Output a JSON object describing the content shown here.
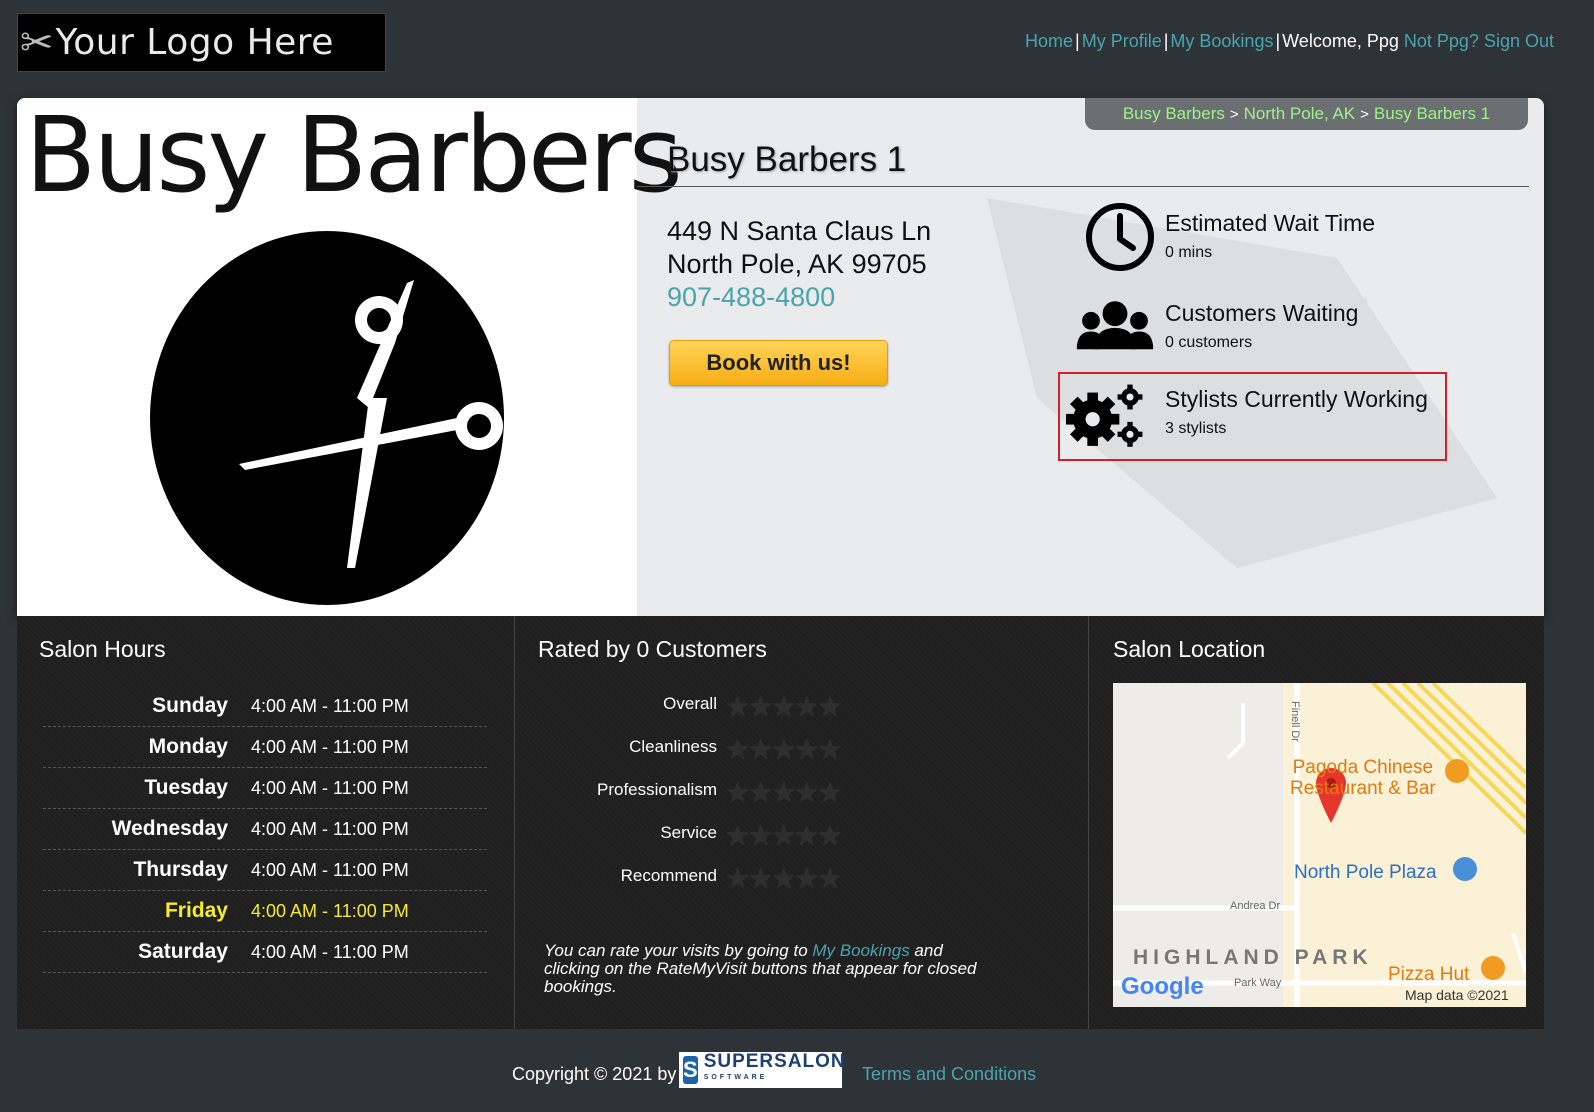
{
  "header": {
    "logo_text": "Your Logo Here",
    "nav": {
      "home": "Home",
      "my_profile": "My Profile",
      "my_bookings": "My Bookings",
      "welcome": "Welcome, Ppg",
      "not_user": "Not Ppg?",
      "sign_out": "Sign Out"
    }
  },
  "breadcrumb": [
    "Busy Barbers",
    "North Pole, AK",
    "Busy Barbers 1"
  ],
  "salon": {
    "brand_name": "Busy Barbers",
    "title": "Busy Barbers 1",
    "address_line1": "449 N Santa Claus Ln",
    "address_line2": "North Pole, AK 99705",
    "phone": "907-488-4800",
    "book_label": "Book with us!"
  },
  "stats": {
    "wait": {
      "title": "Estimated Wait Time",
      "value": "0 mins",
      "icon": "clock-icon"
    },
    "customers": {
      "title": "Customers Waiting",
      "value": "0 customers",
      "icon": "group-icon"
    },
    "stylists": {
      "title": "Stylists Currently Working",
      "value": "3 stylists",
      "icon": "gears-icon"
    }
  },
  "hours": {
    "title": "Salon Hours",
    "today": "Friday",
    "rows": [
      {
        "day": "Sunday",
        "time": "4:00 AM - 11:00 PM"
      },
      {
        "day": "Monday",
        "time": "4:00 AM - 11:00 PM"
      },
      {
        "day": "Tuesday",
        "time": "4:00 AM - 11:00 PM"
      },
      {
        "day": "Wednesday",
        "time": "4:00 AM - 11:00 PM"
      },
      {
        "day": "Thursday",
        "time": "4:00 AM - 11:00 PM"
      },
      {
        "day": "Friday",
        "time": "4:00 AM - 11:00 PM"
      },
      {
        "day": "Saturday",
        "time": "4:00 AM - 11:00 PM"
      }
    ]
  },
  "ratings": {
    "title": "Rated by 0 Customers",
    "categories": [
      {
        "label": "Overall",
        "stars": 0
      },
      {
        "label": "Cleanliness",
        "stars": 0
      },
      {
        "label": "Professionalism",
        "stars": 0
      },
      {
        "label": "Service",
        "stars": 0
      },
      {
        "label": "Recommend",
        "stars": 0
      }
    ],
    "note_before": "You can rate your visits by going to ",
    "note_link": "My Bookings",
    "note_after": " and clicking on the RateMyVisit buttons that appear for closed bookings."
  },
  "location": {
    "title": "Salon Location",
    "map_labels": {
      "street1": "Finell Dr",
      "poi1_line1": "Pagoda Chinese",
      "poi1_line2": "Restaurant & Bar",
      "poi2": "North Pole Plaza",
      "street2": "Andrea Dr",
      "area": "HIGHLAND PARK",
      "poi3": "Pizza Hut",
      "street3": "Park Way",
      "google": "Google",
      "attribution": "Map data ©2021"
    }
  },
  "footer": {
    "copyright": "Copyright © 2021 by",
    "brand_mark": "S",
    "brand_name": "SUPERSALON",
    "brand_sub": "SOFTWARE",
    "terms": "Terms and Conditions"
  }
}
